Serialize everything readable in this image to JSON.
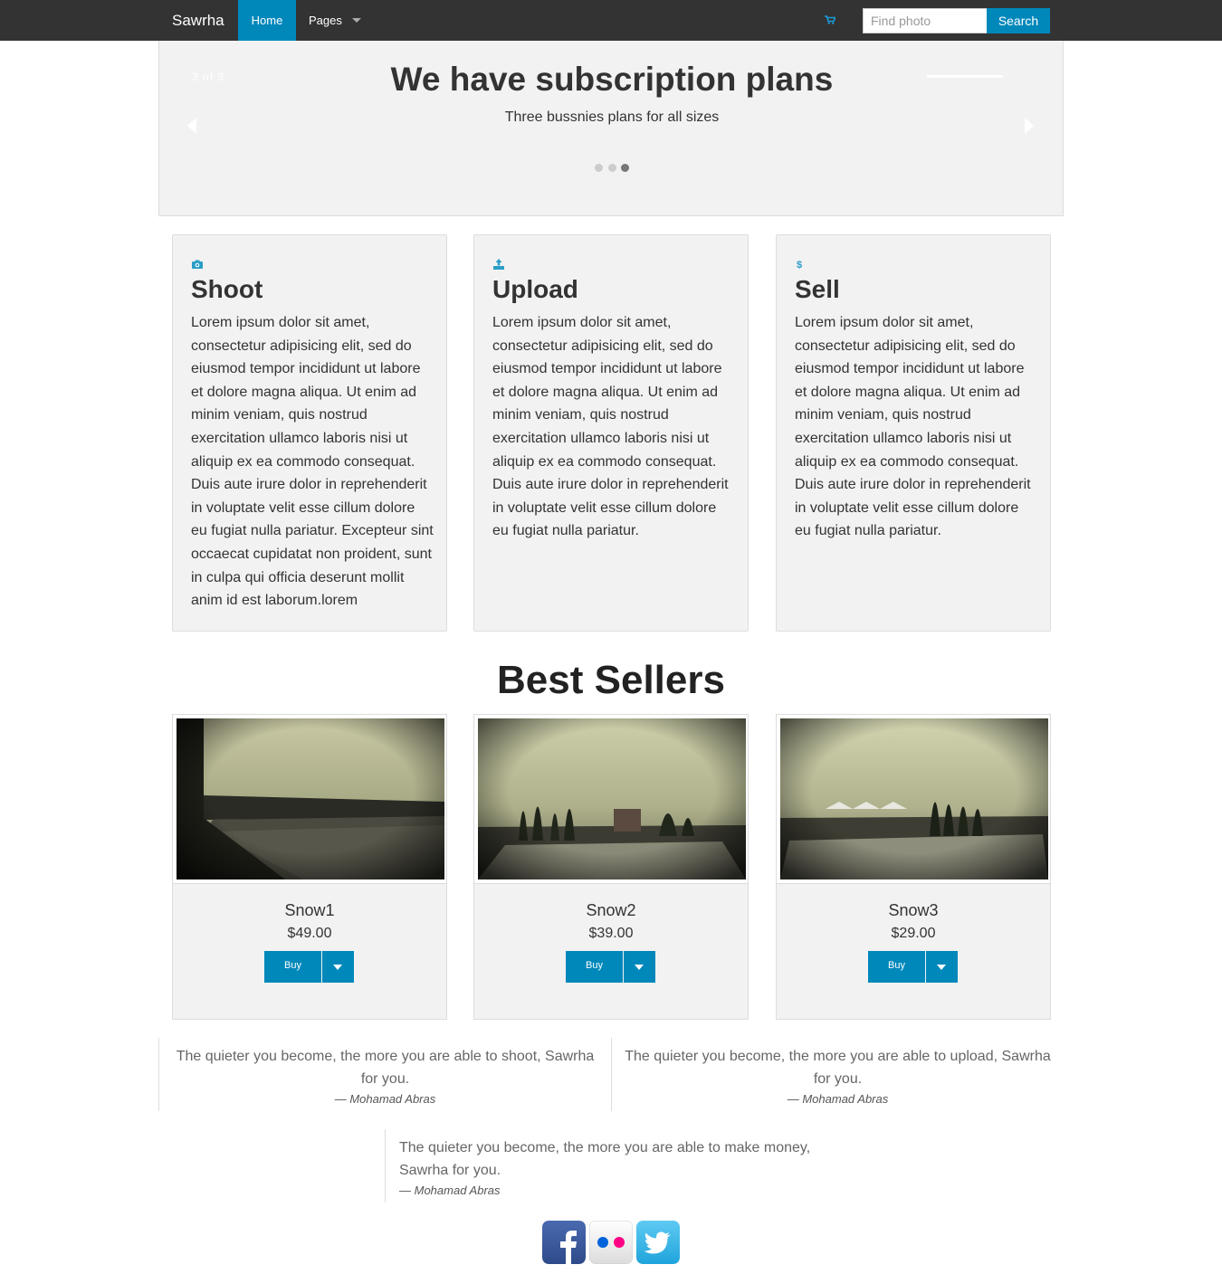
{
  "navbar": {
    "brand": "Sawrha",
    "home_label": "Home",
    "pages_label": "Pages",
    "search_placeholder": "Find photo",
    "search_button": "Search"
  },
  "carousel": {
    "counter": "3 of 3",
    "title": "We have subscription plans",
    "subtitle": "Three bussnies plans for all sizes",
    "slide_count": 3,
    "active_slide": 3
  },
  "features": [
    {
      "icon": "camera-icon",
      "title": "Shoot",
      "text": "Lorem ipsum dolor sit amet, consectetur adipisicing elit, sed do eiusmod tempor incididunt ut labore et dolore magna aliqua. Ut enim ad minim veniam, quis nostrud exercitation ullamco laboris nisi ut aliquip ex ea commodo consequat. Duis aute irure dolor in reprehenderit in voluptate velit esse cillum dolore eu fugiat nulla pariatur. Excepteur sint occaecat cupidatat non proident, sunt in culpa qui officia deserunt mollit anim id est laborum.lorem"
    },
    {
      "icon": "upload-icon",
      "title": "Upload",
      "text": "Lorem ipsum dolor sit amet, consectetur adipisicing elit, sed do eiusmod tempor incididunt ut labore et dolore magna aliqua. Ut enim ad minim veniam, quis nostrud exercitation ullamco laboris nisi ut aliquip ex ea commodo consequat. Duis aute irure dolor in reprehenderit in voluptate velit esse cillum dolore eu fugiat nulla pariatur."
    },
    {
      "icon": "dollar-icon",
      "title": "Sell",
      "text": "Lorem ipsum dolor sit amet, consectetur adipisicing elit, sed do eiusmod tempor incididunt ut labore et dolore magna aliqua. Ut enim ad minim veniam, quis nostrud exercitation ullamco laboris nisi ut aliquip ex ea commodo consequat. Duis aute irure dolor in reprehenderit in voluptate velit esse cillum dolore eu fugiat nulla pariatur."
    }
  ],
  "best_sellers": {
    "title": "Best Sellers",
    "products": [
      {
        "name": "Snow1",
        "price": "$49.00",
        "buy_label": "Buy"
      },
      {
        "name": "Snow2",
        "price": "$39.00",
        "buy_label": "Buy"
      },
      {
        "name": "Snow3",
        "price": "$29.00",
        "buy_label": "Buy"
      }
    ]
  },
  "quotes": [
    {
      "text": "The quieter you become, the more you are able to shoot, Sawrha for you.",
      "author": "— Mohamad Abras"
    },
    {
      "text": "The quieter you become, the more you are able to upload, Sawrha for you.",
      "author": "— Mohamad Abras"
    },
    {
      "text": "The quieter you become, the more you are able to make money, Sawrha for you.",
      "author": "— Mohamad Abras"
    }
  ],
  "social": {
    "icons": [
      "facebook-icon",
      "flickr-icon",
      "twitter-icon"
    ]
  },
  "colors": {
    "accent": "#0088bb",
    "navbar": "#333333",
    "panel": "#f2f2f2"
  }
}
